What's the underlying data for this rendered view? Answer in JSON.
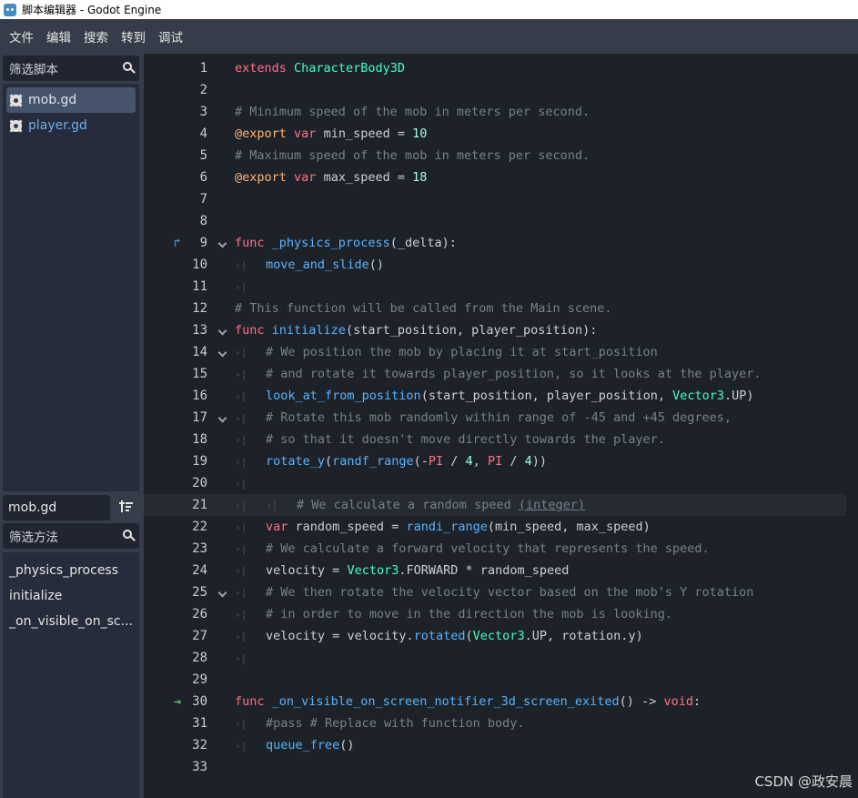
{
  "window": {
    "title": "脚本编辑器 - Godot Engine"
  },
  "menu": [
    "文件",
    "编辑",
    "搜索",
    "转到",
    "调试"
  ],
  "scripts": {
    "filter_placeholder": "筛选脚本",
    "items": [
      {
        "label": "mob.gd",
        "selected": true
      },
      {
        "label": "player.gd",
        "selected": false
      }
    ]
  },
  "current_script": "mob.gd",
  "methods": {
    "filter_placeholder": "筛选方法",
    "items": [
      "_physics_process",
      "initialize",
      "_on_visible_on_sc..."
    ]
  },
  "code": [
    "extends CharacterBody3D",
    "",
    "# Minimum speed of the mob in meters per second.",
    "@export var min_speed = 10",
    "# Maximum speed of the mob in meters per second.",
    "@export var max_speed = 18",
    "",
    "",
    "func _physics_process(_delta):",
    "\tmove_and_slide()",
    "",
    "# This function will be called from the Main scene.",
    "func initialize(start_position, player_position):",
    "\t# We position the mob by placing it at start_position",
    "\t# and rotate it towards player_position, so it looks at the player.",
    "\tlook_at_from_position(start_position, player_position, Vector3.UP)",
    "\t# Rotate this mob randomly within range of -45 and +45 degrees,",
    "\t# so that it doesn't move directly towards the player.",
    "\trotate_y(randf_range(-PI / 4, PI / 4))",
    "",
    "\t\t# We calculate a random speed (integer)",
    "\tvar random_speed = randi_range(min_speed, max_speed)",
    "\t# We calculate a forward velocity that represents the speed.",
    "\tvelocity = Vector3.FORWARD * random_speed",
    "\t# We then rotate the velocity vector based on the mob's Y rotation",
    "\t# in order to move in the direction the mob is looking.",
    "\tvelocity = velocity.rotated(Vector3.UP, rotation.y)",
    "",
    "",
    "func _on_visible_on_screen_notifier_3d_screen_exited() -> void:",
    "\t#pass # Replace with function body.",
    "\tqueue_free()",
    ""
  ],
  "watermark": "CSDN @政安晨"
}
